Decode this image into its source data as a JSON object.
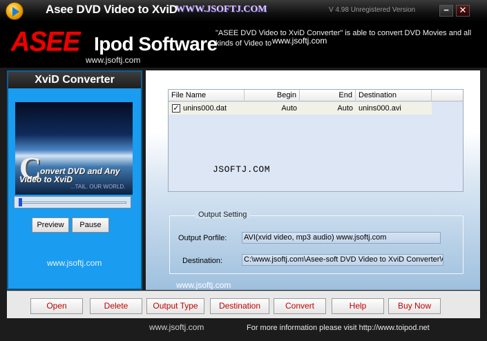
{
  "window": {
    "title": "Asee DVD Video to XviD",
    "title_watermark": "WWW.JSOFTJ.COM",
    "version": "V 4.98 Unregistered Version",
    "minimize": "−",
    "close": "✕"
  },
  "banner": {
    "logo_red": "ASEE",
    "logo_white": "Ipod Software",
    "url": "www.jsoftj.com",
    "description": "\"ASEE DVD Video to XviD Converter\" is able to convert DVD Movies and all kinds of  Video to",
    "desc_url": "www.jsoftj.com"
  },
  "left_panel": {
    "heading": "XviD Converter",
    "preview_letter": "C",
    "preview_caption": "onvert DVD and Any Video to XviD",
    "preview_small": "...TAIL. OUR WORLD.",
    "slider_position": 0.0,
    "preview_button": "Preview",
    "pause_button": "Pause",
    "url": "www.jsoftj.com"
  },
  "file_table": {
    "columns": [
      "File Name",
      "Begin",
      "End",
      "Destination"
    ],
    "rows": [
      {
        "checked": true,
        "file_name": "unins000.dat",
        "begin": "Auto",
        "end": "Auto",
        "destination": "unins000.avi"
      }
    ],
    "check_glyph": "✓",
    "watermark": "JSOFTJ.COM"
  },
  "output_setting": {
    "legend": "Output Setting",
    "profile_label": "Output Porfile:",
    "profile_value": "AVI(xvid video, mp3 audio) www.jsoftj.com",
    "destination_label": "Destination:",
    "destination_value": "C:\\www.jsoftj.com\\Asee-soft DVD Video to XviD Converter\\O"
  },
  "right_url": "www.jsoftj.com",
  "toolbar": {
    "open": "Open",
    "delete": "Delete",
    "output_type": "Output Type",
    "destination": "Destination",
    "convert": "Convert",
    "help": "Help",
    "buy_now": "Buy Now"
  },
  "footer": {
    "url": "www.jsoftj.com",
    "info": "For more information please visit http://www.toipod.net"
  },
  "colors": {
    "accent_blue": "#1a9cf0",
    "logo_red": "#e00000",
    "button_text_red": "#c00000"
  }
}
